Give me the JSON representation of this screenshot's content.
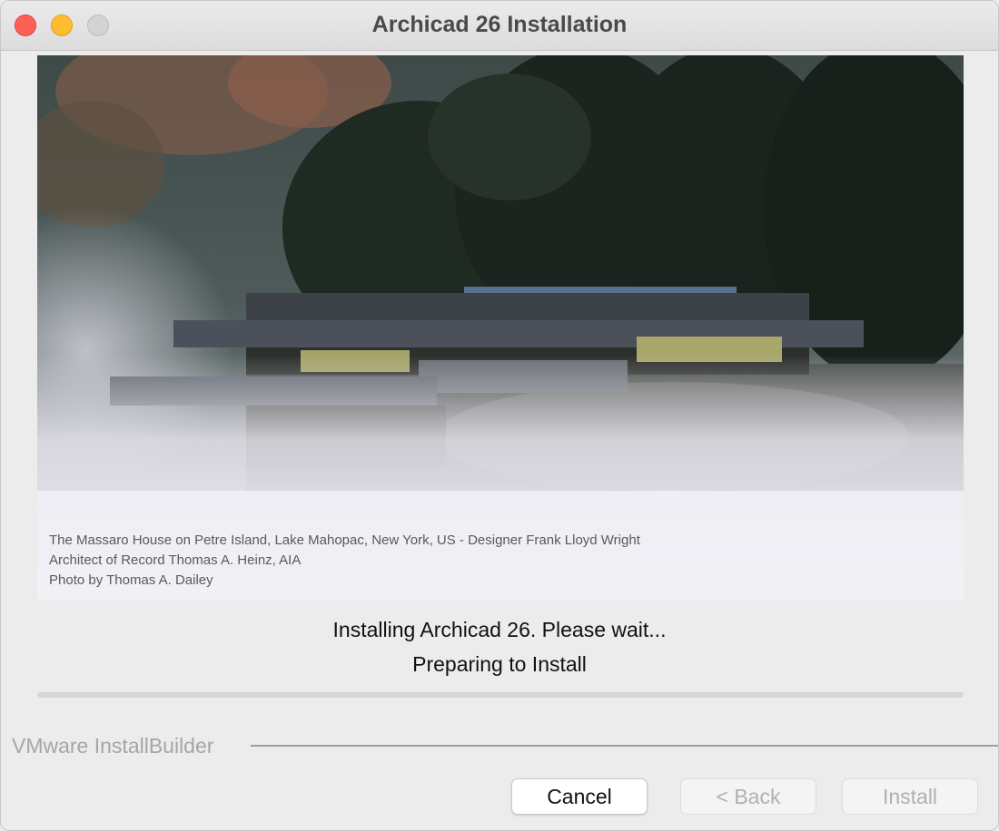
{
  "window": {
    "title": "Archicad 26 Installation"
  },
  "banner": {
    "caption_lines": [
      "The Massaro House on Petre Island, Lake Mahopac, New York, US - Designer Frank Lloyd Wright",
      "Architect of Record Thomas A. Heinz, AIA",
      "Photo by Thomas A. Dailey"
    ]
  },
  "status": {
    "line1": "Installing Archicad 26. Please wait...",
    "line2": "Preparing to Install",
    "progress": 0
  },
  "footer": {
    "brand": "VMware InstallBuilder",
    "buttons": {
      "cancel": "Cancel",
      "back": "< Back",
      "install": "Install"
    }
  },
  "colors": {
    "close": "#fe5f57",
    "minimize": "#febc2e",
    "maximize_disabled": "#d3d3d3",
    "progress_fill": "#3b82f6"
  }
}
